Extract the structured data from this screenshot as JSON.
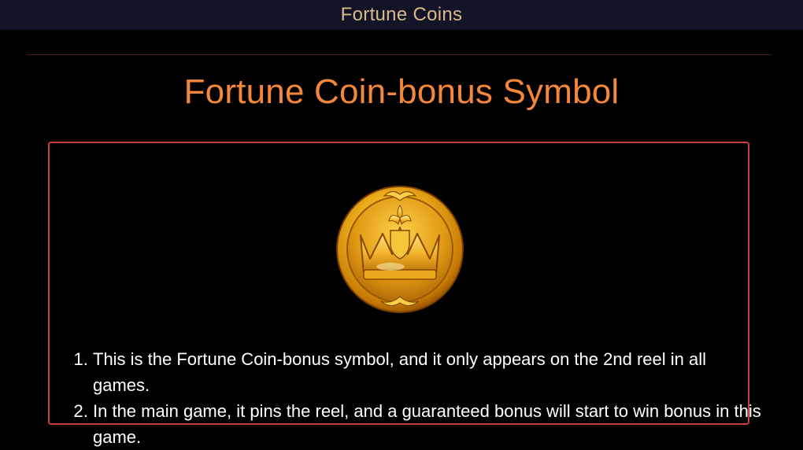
{
  "header": {
    "title": "Fortune Coins"
  },
  "section": {
    "heading": "Fortune Coin-bonus Symbol"
  },
  "symbol": {
    "icon": "crown-coin-icon"
  },
  "rules": [
    "This is the Fortune Coin-bonus symbol, and it only appears on the 2nd reel in all games.",
    "In the main game, it pins the reel, and a guaranteed bonus will start to win bonus in this game."
  ],
  "colors": {
    "header_bg": "#141428",
    "header_text": "#d9b98a",
    "heading": "#f5873a",
    "panel_border": "#c84035",
    "coin_gold": "#e8a417"
  }
}
